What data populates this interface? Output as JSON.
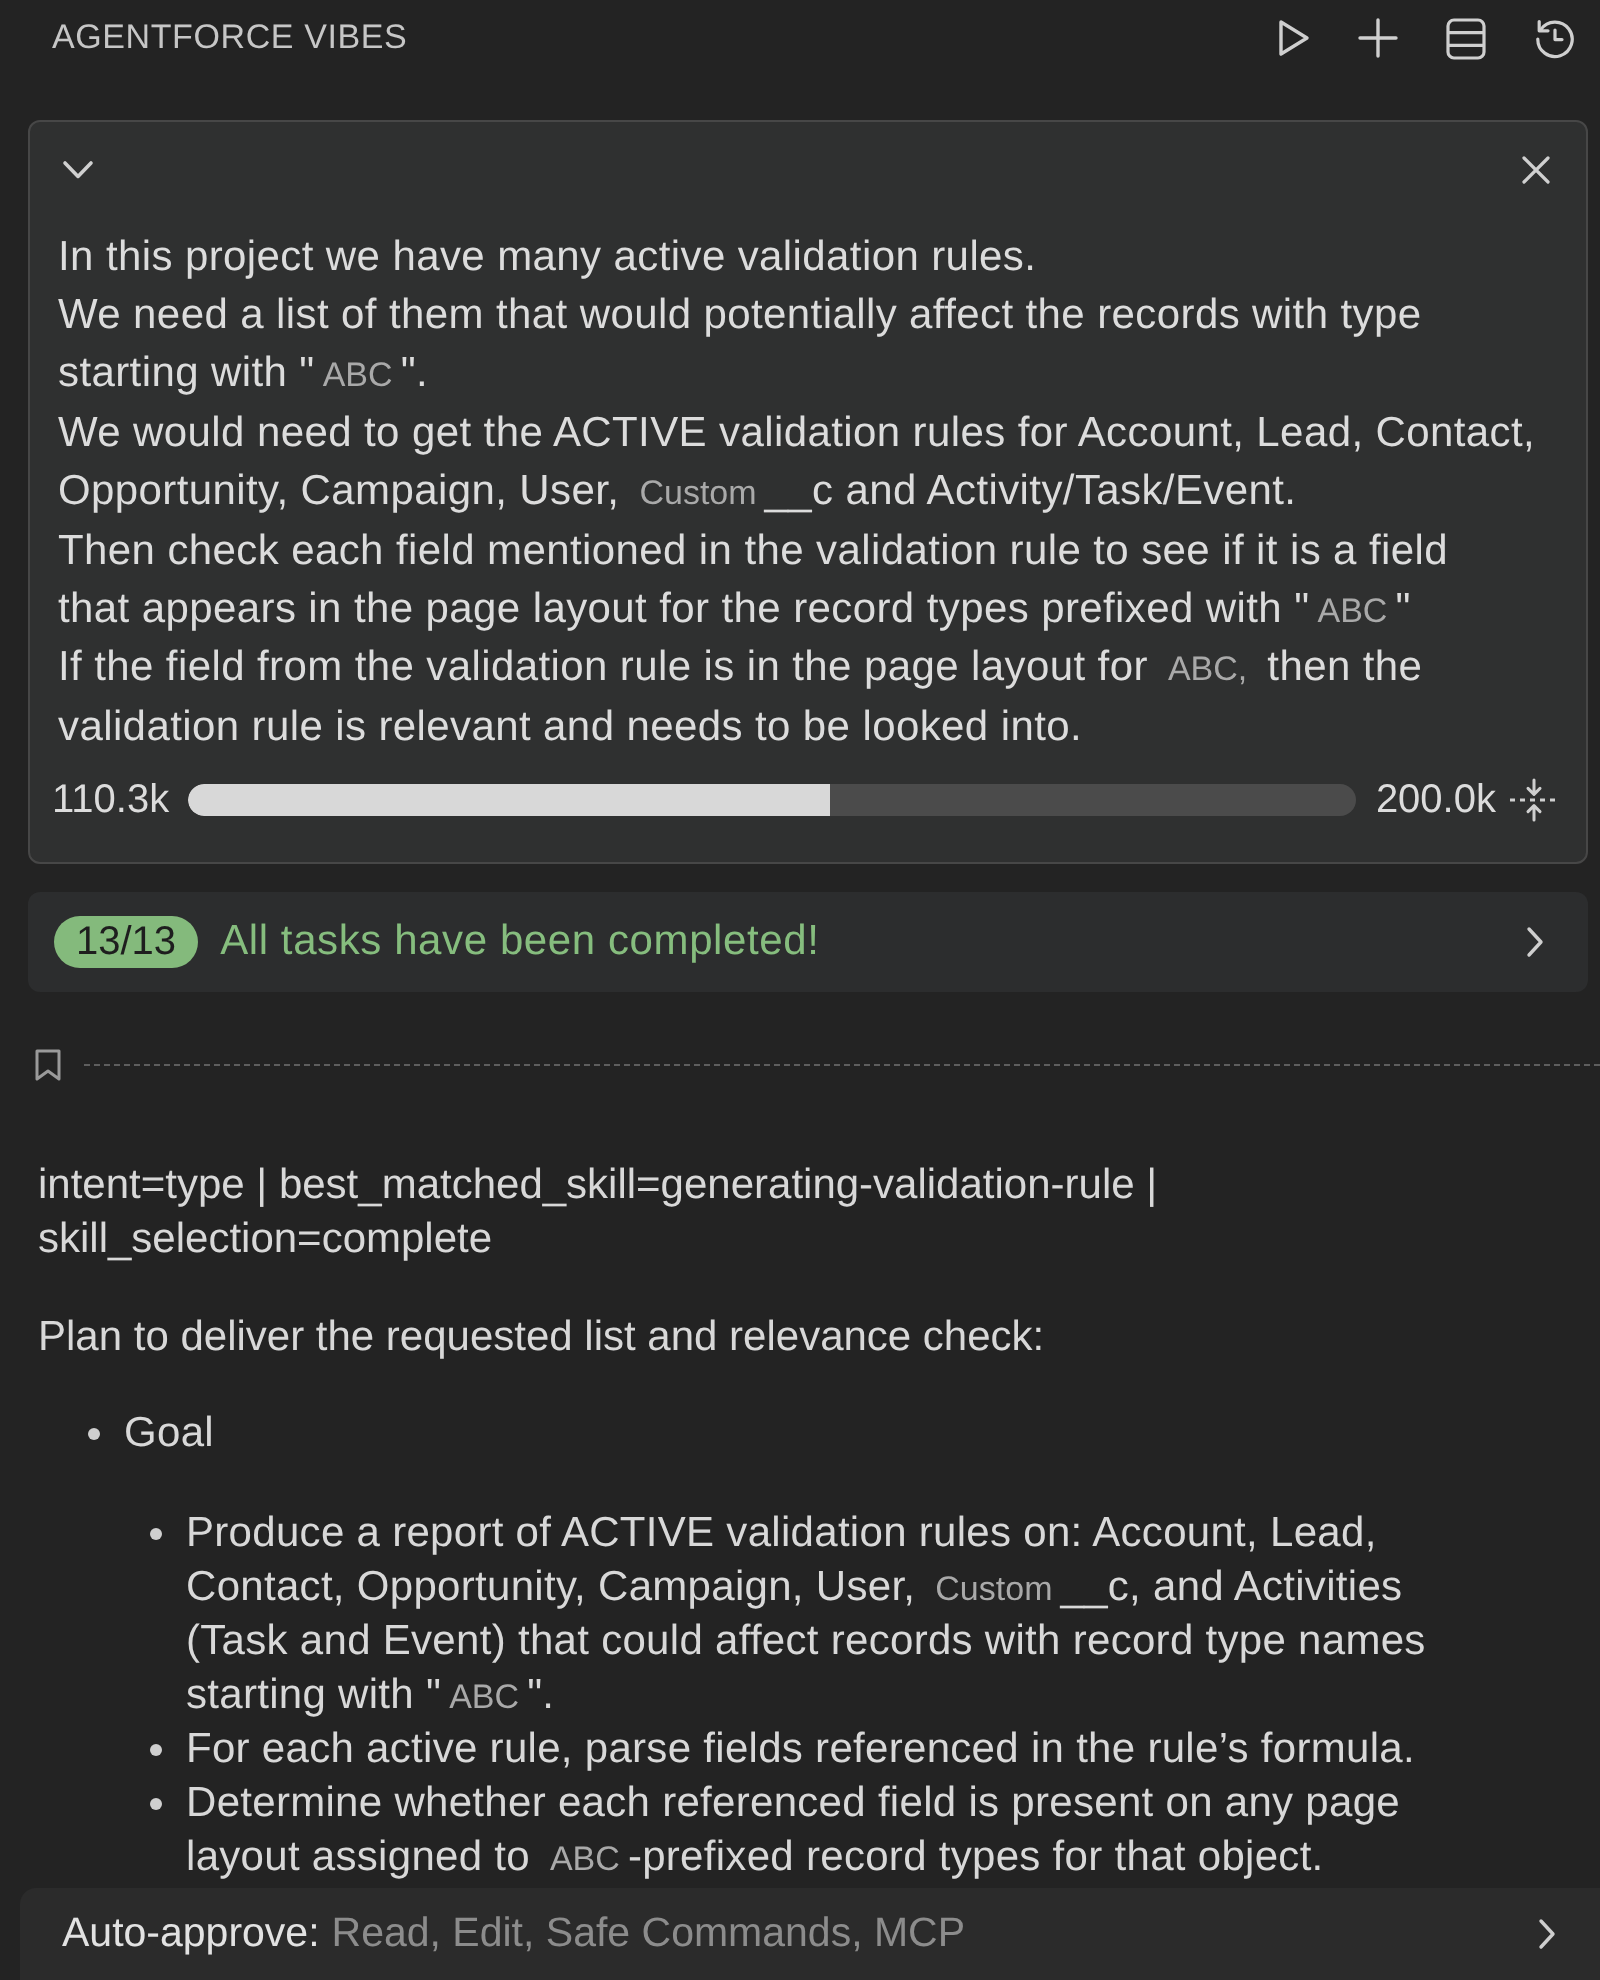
{
  "header": {
    "title": "AGENTFORCE VIBES"
  },
  "prompt_card": {
    "paragraphs": [
      [
        {
          "kind": "text",
          "text": "In this project we have many active validation rules."
        }
      ],
      [
        {
          "kind": "text",
          "text": "We need a list of them that would potentially affect the records with type\nstarting with \""
        },
        {
          "kind": "code",
          "text": "ABC"
        },
        {
          "kind": "text",
          "text": "\"."
        }
      ],
      [
        {
          "kind": "text",
          "text": "We would need to get the ACTIVE validation rules for Account, Lead, Contact,\nOpportunity, Campaign, User, "
        },
        {
          "kind": "code",
          "text": "Custom"
        },
        {
          "kind": "text",
          "text": "__c and Activity/Task/Event."
        }
      ],
      [
        {
          "kind": "text",
          "text": "Then check each field mentioned in the validation rule to see if it is a field\nthat appears in the page layout for the record types prefixed with \""
        },
        {
          "kind": "code",
          "text": "ABC"
        },
        {
          "kind": "text",
          "text": "\""
        }
      ],
      [
        {
          "kind": "text",
          "text": "If the field from the validation rule is in the page layout for "
        },
        {
          "kind": "code",
          "text": "ABC,"
        },
        {
          "kind": "text",
          "text": " then the\nvalidation rule is relevant and needs to be looked into."
        }
      ]
    ],
    "context": {
      "used": "110.3k",
      "limit": "200.0k",
      "level": 0.55
    }
  },
  "tasks": {
    "count": "13/13",
    "message": "All tasks have been completed!",
    "completed": true
  },
  "response": {
    "paragraphs": [
      [
        {
          "kind": "text",
          "text": "intent=type | best_matched_skill=generating-validation-rule |\nskill_selection=complete"
        }
      ],
      [
        {
          "kind": "text",
          "text": "Plan to deliver the requested list and relevance check:"
        }
      ]
    ],
    "list": [
      {
        "parts": [
          {
            "kind": "text",
            "text": "Goal"
          }
        ],
        "children": [
          {
            "parts": [
              {
                "kind": "text",
                "text": "Produce a report of ACTIVE validation rules on: Account, Lead,\nContact, Opportunity, Campaign, User, "
              },
              {
                "kind": "code",
                "text": "Custom"
              },
              {
                "kind": "text",
                "text": "__c, and Activities\n(Task and Event) that could affect records with record type names\nstarting with \""
              },
              {
                "kind": "code",
                "text": "ABC"
              },
              {
                "kind": "text",
                "text": "\"."
              }
            ]
          },
          {
            "parts": [
              {
                "kind": "text",
                "text": "For each active rule, parse fields referenced in the rule’s formula."
              }
            ]
          },
          {
            "parts": [
              {
                "kind": "text",
                "text": "Determine whether each referenced field is present on any page\nlayout assigned to "
              },
              {
                "kind": "code",
                "text": "ABC"
              },
              {
                "kind": "text",
                "text": "-prefixed record types for that object."
              }
            ]
          }
        ]
      }
    ]
  },
  "footer": {
    "label": "Auto-approve:",
    "value": "Read, Edit, Safe Commands, MCP"
  }
}
